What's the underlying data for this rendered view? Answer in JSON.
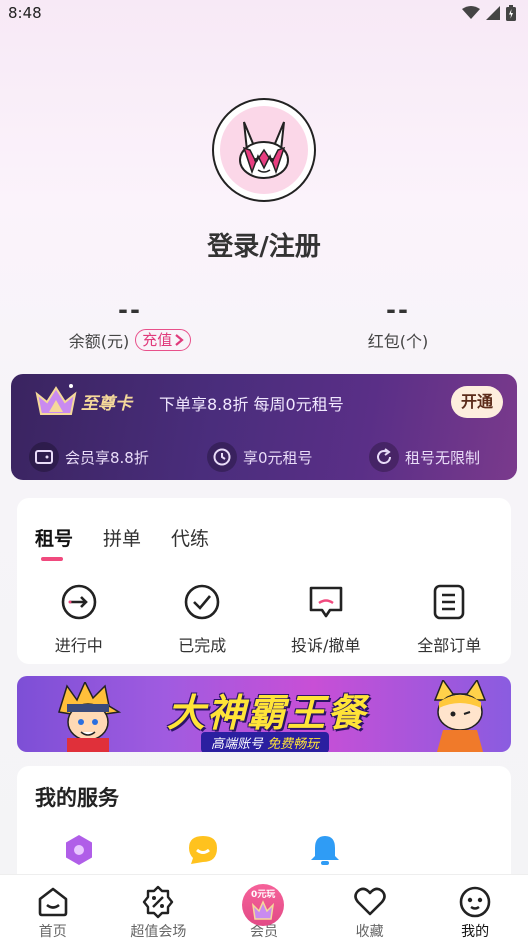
{
  "status_bar": {
    "time": "8:48"
  },
  "profile": {
    "login_label": "登录/注册"
  },
  "stats": {
    "balance": {
      "value": "--",
      "label": "余额(元)",
      "action": "充值"
    },
    "red_packet": {
      "value": "--",
      "label": "红包(个)"
    }
  },
  "vip": {
    "brand": "至尊卡",
    "description": "下单享8.8折 每周0元租号",
    "open_button": "开通",
    "perks": [
      {
        "icon": "wallet-icon",
        "label": "会员享8.8折"
      },
      {
        "icon": "clock-icon",
        "label": "享0元租号"
      },
      {
        "icon": "refresh-icon",
        "label": "租号无限制"
      }
    ]
  },
  "orders": {
    "tabs": [
      {
        "label": "租号",
        "active": true
      },
      {
        "label": "拼单",
        "active": false
      },
      {
        "label": "代练",
        "active": false
      }
    ],
    "actions": [
      {
        "icon": "in-progress-icon",
        "label": "进行中"
      },
      {
        "icon": "check-circle-icon",
        "label": "已完成"
      },
      {
        "icon": "complaint-icon",
        "label": "投诉/撤单"
      },
      {
        "icon": "all-orders-icon",
        "label": "全部订单"
      }
    ]
  },
  "banner": {
    "title": "大神霸王餐",
    "subtitle_prefix": "高端账号",
    "subtitle_highlight": "免费畅玩"
  },
  "services": {
    "title": "我的服务",
    "icons": [
      "hexagon-icon",
      "chat-bubble-icon",
      "bell-icon"
    ]
  },
  "bottom_nav": {
    "items": [
      {
        "icon": "home-icon",
        "label": "首页",
        "active": false
      },
      {
        "icon": "discount-icon",
        "label": "超值会场",
        "active": false
      },
      {
        "icon": "member-icon",
        "label": "会员",
        "badge": "0元玩",
        "active": false
      },
      {
        "icon": "heart-icon",
        "label": "收藏",
        "active": false
      },
      {
        "icon": "face-icon",
        "label": "我的",
        "active": true
      }
    ]
  },
  "colors": {
    "accent": "#f04a7e",
    "vip_gold": "#f5d99a",
    "vip_bg": "#4a2d7c",
    "banner_yellow": "#ffe438"
  }
}
